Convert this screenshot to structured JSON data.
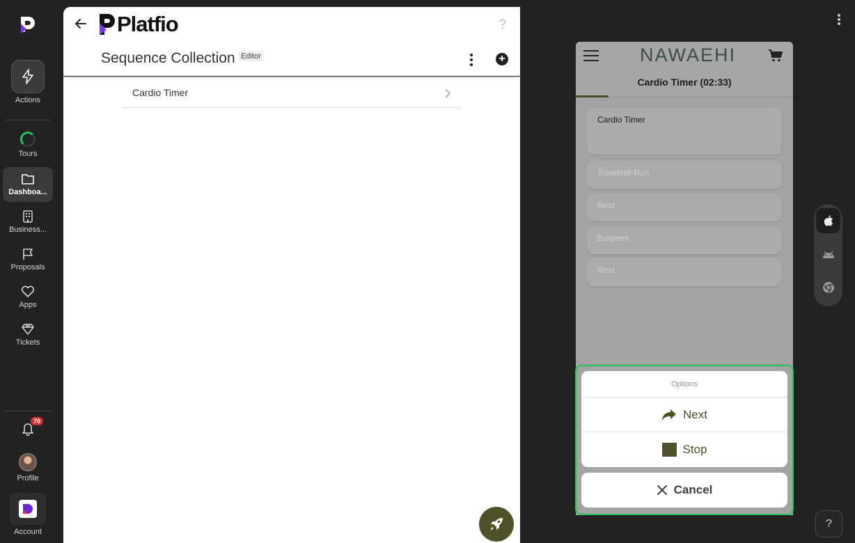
{
  "rail": {
    "actions_label": "Actions",
    "tours_label": "Tours",
    "dashboard_label": "Dashboa...",
    "business_label": "Business...",
    "proposals_label": "Proposals",
    "apps_label": "Apps",
    "tickets_label": "Tickets",
    "notification_count": "70",
    "profile_label": "Profile",
    "account_label": "Account"
  },
  "editor": {
    "brand": "Platfio",
    "help": "?",
    "title": "Sequence Collection",
    "mode_chip": "Editor",
    "add": "+",
    "items": [
      {
        "label": "Cardio Timer"
      }
    ]
  },
  "preview": {
    "app_name": "NAWAEHI",
    "screen_title": "Cardio Timer (02:33)",
    "steps": [
      "Cardio Timer",
      "Treadmill Run",
      "Rest",
      "Burpees",
      "Rest"
    ],
    "sheet": {
      "header": "Options",
      "next_label": "Next",
      "stop_label": "Stop",
      "cancel_label": "Cancel"
    },
    "help": "?"
  },
  "colors": {
    "accent_olive": "#4f5129",
    "highlight_green": "#22c55e",
    "badge_red": "#d32f2f"
  },
  "icons": {
    "rail": [
      "bolt-icon",
      "folder-icon",
      "building-icon",
      "flag-icon",
      "heart-icon",
      "diamond-icon",
      "bell-icon"
    ],
    "platforms": [
      "apple-icon",
      "android-icon",
      "chrome-icon"
    ]
  }
}
